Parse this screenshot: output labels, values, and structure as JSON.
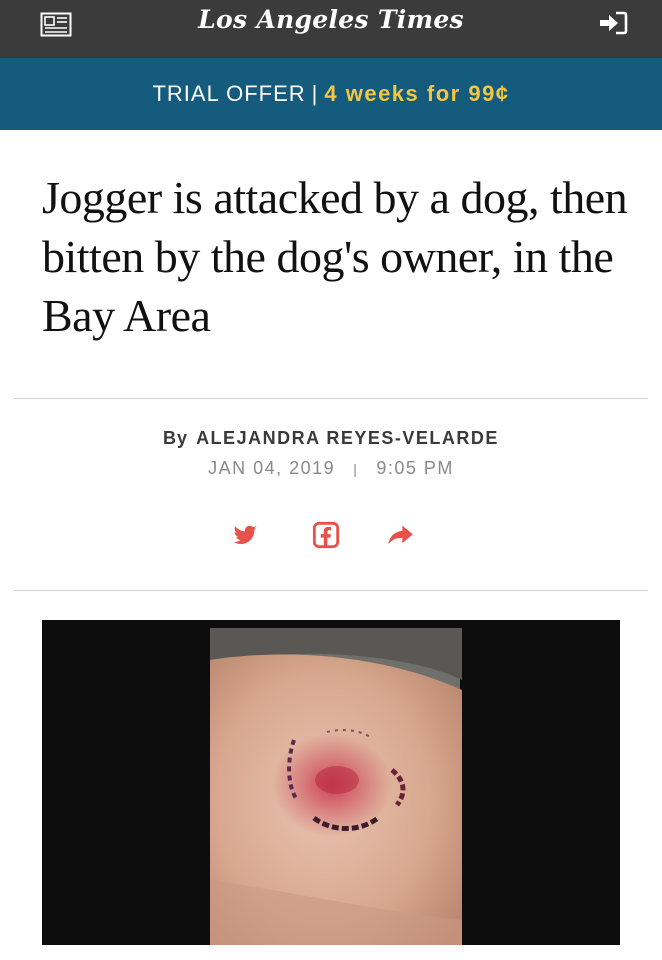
{
  "header": {
    "logo": "Los Angeles Times",
    "menu_icon": "newspaper-icon",
    "signin_icon": "sign-in-icon",
    "background": "#3b3b3b"
  },
  "promo": {
    "label": "TRIAL OFFER",
    "separator": "|",
    "deal": "4 weeks for 99¢",
    "background": "#155b7e",
    "deal_color": "#f5c63f"
  },
  "article": {
    "headline": "Jogger is attacked by a dog, then bitten by the dog's owner, in the Bay Area",
    "byline_prefix": "By",
    "author": "ALEJANDRA REYES-VELARDE",
    "date": "JAN 04, 2019",
    "date_separator": "|",
    "time": "9:05 PM"
  },
  "share": {
    "icons": [
      "twitter-icon",
      "facebook-icon",
      "share-forward-icon"
    ],
    "color": "#e8504a"
  },
  "image": {
    "subject": "bite-wound-photo"
  }
}
